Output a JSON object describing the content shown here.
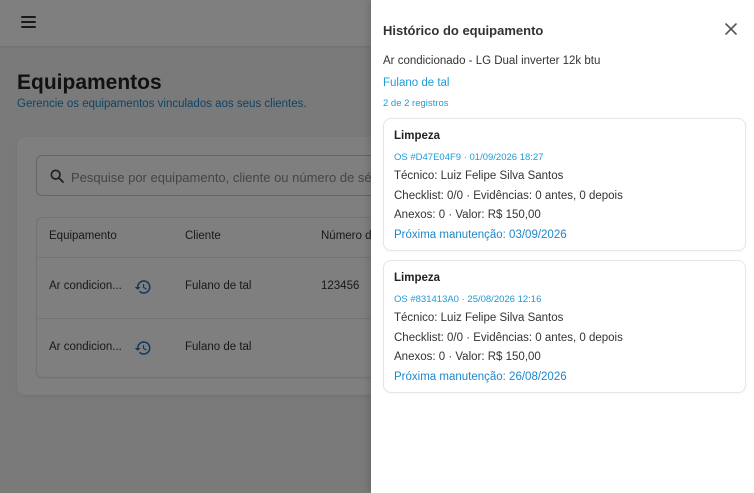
{
  "page": {
    "title": "Equipamentos",
    "subtitle": "Gerencie os equipamentos vinculados aos seus clientes."
  },
  "search": {
    "placeholder": "Pesquise por equipamento, cliente ou número de série"
  },
  "table": {
    "headers": [
      "Equipamento",
      "Cliente",
      "Número d"
    ],
    "rows": [
      {
        "equipment": "Ar condicion...",
        "client": "Fulano de tal",
        "serial": "123456"
      },
      {
        "equipment": "Ar condicion...",
        "client": "Fulano de tal",
        "serial": ""
      }
    ]
  },
  "drawer": {
    "title": "Histórico do equipamento",
    "equipment": "Ar condicionado - LG Dual inverter 12k btu",
    "client": "Fulano de tal",
    "count": "2 de 2 registros",
    "records": [
      {
        "type": "Limpeza",
        "os": "OS #D47E04F9 · 01/09/2026 18:27",
        "technician": "Técnico: Luiz Felipe Silva Santos",
        "checklist": "Checklist: 0/0 · Evidências: 0 antes, 0 depois",
        "attachments": "Anexos: 0 · Valor: R$ 150,00",
        "next": "Próxima manutenção: 03/09/2026"
      },
      {
        "type": "Limpeza",
        "os": "OS #831413A0 · 25/08/2026 12:16",
        "technician": "Técnico: Luiz Felipe Silva Santos",
        "checklist": "Checklist: 0/0 · Evidências: 0 antes, 0 depois",
        "attachments": "Anexos: 0 · Valor: R$ 150,00",
        "next": "Próxima manutenção: 26/08/2026"
      }
    ]
  },
  "icons": {
    "menu": "menu-icon",
    "search": "search-icon",
    "history": "history-icon",
    "close": "close-icon"
  },
  "colors": {
    "accent": "#1e88c8",
    "link": "#1e9bd7",
    "overlay": "rgba(0,0,0,0.5)"
  }
}
